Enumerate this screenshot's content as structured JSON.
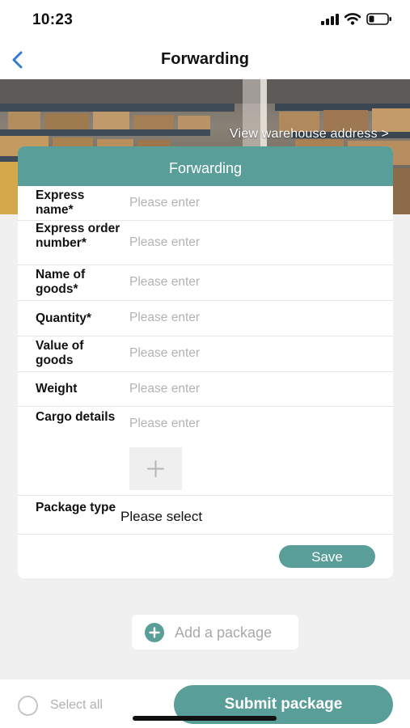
{
  "status_bar": {
    "time": "10:23"
  },
  "nav": {
    "title": "Forwarding",
    "back_icon": "chevron-left-icon"
  },
  "banner": {
    "link_text": "View warehouse address >"
  },
  "card": {
    "header": "Forwarding",
    "fields": [
      {
        "label": "Express name*",
        "placeholder": "Please enter"
      },
      {
        "label": "Express order number*",
        "placeholder": "Please enter"
      },
      {
        "label": "Name of goods*",
        "placeholder": "Please enter"
      },
      {
        "label": "Quantity*",
        "placeholder": "Please enter"
      },
      {
        "label": "Value of goods",
        "placeholder": "Please enter"
      },
      {
        "label": "Weight",
        "placeholder": "Please enter"
      },
      {
        "label": "Cargo details",
        "placeholder": "Please enter"
      }
    ],
    "package_type": {
      "label": "Package type",
      "value": "Please select"
    },
    "upload_icon": "plus-icon",
    "save_label": "Save"
  },
  "add_package": {
    "label": "Add a package",
    "icon": "plus-circle-icon"
  },
  "bottom": {
    "select_all": "Select all",
    "submit": "Submit package"
  },
  "colors": {
    "accent": "#5a9e99",
    "placeholder": "#b3b3b3",
    "background": "#f0f0f0"
  }
}
